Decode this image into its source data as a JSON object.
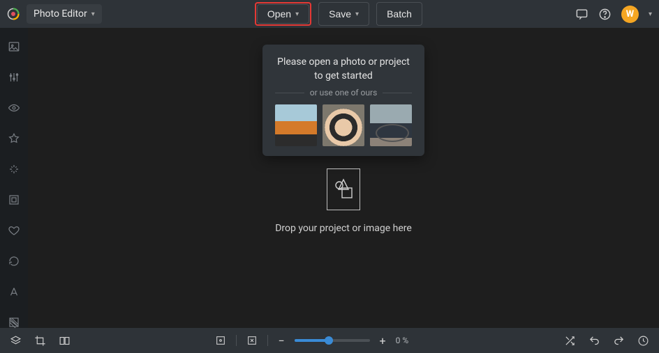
{
  "header": {
    "mode_label": "Photo Editor",
    "open_label": "Open",
    "save_label": "Save",
    "batch_label": "Batch",
    "avatar_letter": "W"
  },
  "sidebar": {
    "items": [
      {
        "name": "image-tool",
        "icon": "image"
      },
      {
        "name": "adjust-tool",
        "icon": "sliders"
      },
      {
        "name": "eye-tool",
        "icon": "eye"
      },
      {
        "name": "favorites-tool",
        "icon": "star"
      },
      {
        "name": "effects-tool",
        "icon": "sparkle"
      },
      {
        "name": "frame-tool",
        "icon": "frame"
      },
      {
        "name": "heart-tool",
        "icon": "heart"
      },
      {
        "name": "transform-tool",
        "icon": "rotate"
      },
      {
        "name": "text-tool",
        "icon": "text"
      },
      {
        "name": "texture-tool",
        "icon": "texture"
      }
    ]
  },
  "popover": {
    "message": "Please open a photo or project to get started",
    "or_text": "or use one of ours",
    "samples": [
      "sample-van",
      "sample-woman",
      "sample-bicycle"
    ]
  },
  "dropzone": {
    "text": "Drop your project or image here"
  },
  "bottombar": {
    "zoom_label": "0 %",
    "zoom_value": 0
  }
}
